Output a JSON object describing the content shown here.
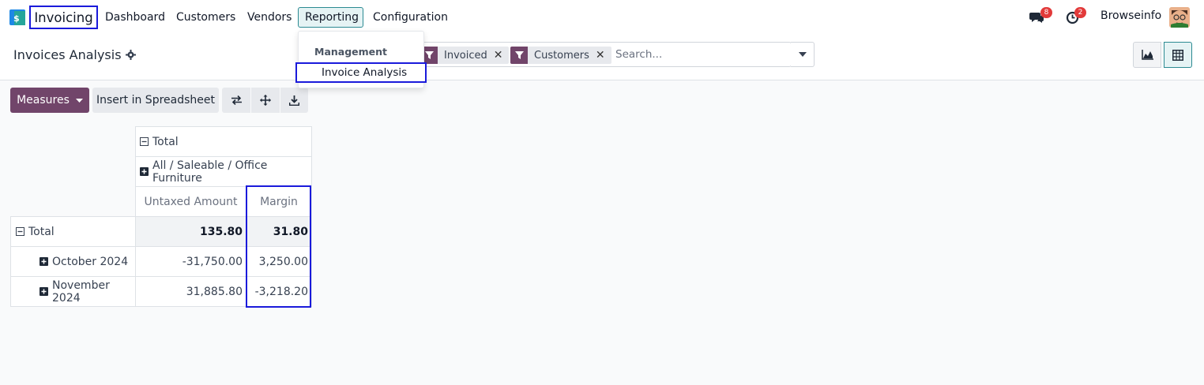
{
  "app": {
    "name": "Invoicing"
  },
  "nav": {
    "items": [
      {
        "label": "Dashboard"
      },
      {
        "label": "Customers"
      },
      {
        "label": "Vendors"
      },
      {
        "label": "Reporting"
      },
      {
        "label": "Configuration"
      }
    ],
    "active": "Reporting"
  },
  "systray": {
    "messages_count": "8",
    "activities_count": "2",
    "user_name": "Browseinfo"
  },
  "reporting_menu": {
    "section": "Management",
    "item": "Invoice Analysis"
  },
  "page": {
    "title": "Invoices Analysis"
  },
  "search": {
    "facets": [
      {
        "label": "Invoiced"
      },
      {
        "label": "Customers"
      }
    ],
    "placeholder": "Search..."
  },
  "toolbar": {
    "measures_label": "Measures",
    "spreadsheet_label": "Insert in Spreadsheet"
  },
  "pivot": {
    "col_header_total": "Total",
    "col_group": "All / Saleable / Office Furniture",
    "measures": [
      "Untaxed Amount",
      "Margin"
    ],
    "rows": [
      {
        "label": "Total",
        "untaxed": "135.80",
        "margin": "31.80"
      },
      {
        "label": "October 2024",
        "untaxed": "-31,750.00",
        "margin": "3,250.00"
      },
      {
        "label": "November 2024",
        "untaxed": "31,885.80",
        "margin": "-3,218.20"
      }
    ]
  },
  "colors": {
    "brand": "#71456a",
    "highlight": "#1a1adb",
    "accent": "#2b8a92"
  }
}
